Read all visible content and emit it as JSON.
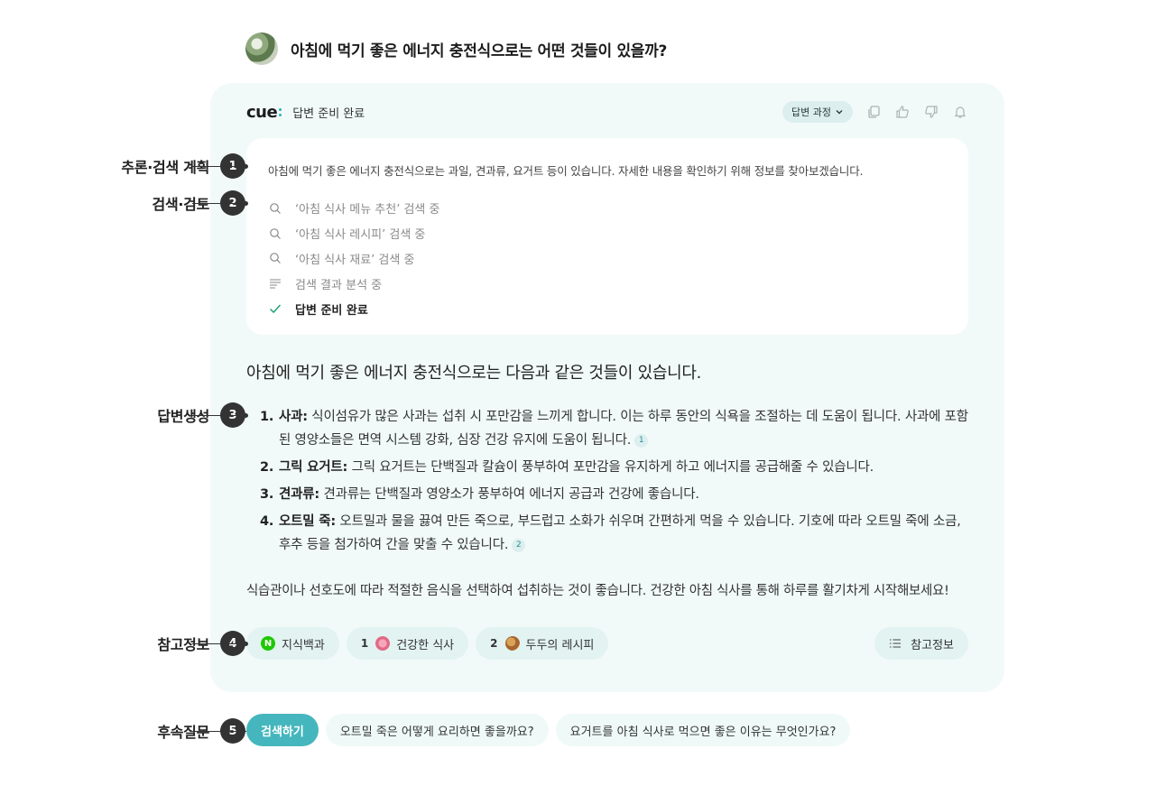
{
  "question": {
    "text": "아침에 먹기 좋은 에너지 충전식으로는 어떤 것들이 있을까?"
  },
  "card": {
    "logo": "cue",
    "status_title": "답변 준비 완료",
    "process_label": "답변 과정",
    "plan_text": "아침에 먹기 좋은 에너지 충전식으로는 과일, 견과류, 요거트 등이 있습니다. 자세한 내용을 확인하기 위해 정보를 찾아보겠습니다.",
    "steps": [
      {
        "icon": "search-icon",
        "text": "‘아침 식사 메뉴 추천’ 검색 중"
      },
      {
        "icon": "search-icon",
        "text": "‘아침 식사 레시피’ 검색 중"
      },
      {
        "icon": "search-icon",
        "text": "‘아침 식사 재료’ 검색 중"
      },
      {
        "icon": "lines-icon",
        "text": "검색 결과 분석 중"
      },
      {
        "icon": "check-icon",
        "text": "답변 준비 완료"
      }
    ],
    "answer_lead": "아침에 먹기 좋은 에너지 충전식으로는 다음과 같은 것들이 있습니다.",
    "items": [
      {
        "num": "1.",
        "term": "사과:",
        "text": " 식이섬유가 많은 사과는 섭취 시 포만감을 느끼게 합니다. 이는 하루 동안의 식욕을 조절하는 데 도움이 됩니다. 사과에 포함된 영양소들은 면역 시스템 강화, 심장 건강 유지에 도움이 됩니다.",
        "cite": "1"
      },
      {
        "num": "2.",
        "term": "그릭 요거트:",
        "text": " 그릭 요거트는 단백질과 칼슘이 풍부하여 포만감을 유지하게 하고 에너지를 공급해줄 수 있습니다.",
        "cite": ""
      },
      {
        "num": "3.",
        "term": "견과류:",
        "text": " 견과류는 단백질과 영양소가 풍부하여 에너지 공급과 건강에 좋습니다.",
        "cite": ""
      },
      {
        "num": "4.",
        "term": "오트밀 죽:",
        "text": " 오트밀과 물을 끓여 만든 죽으로, 부드럽고 소화가 쉬우며 간편하게 먹을 수 있습니다. 기호에 따라 오트밀 죽에 소금, 후추 등을 첨가하여 간을 맞출 수 있습니다.",
        "cite": "2"
      }
    ],
    "closing": "식습관이나 선호도에 따라 적절한 음식을 선택하여 섭취하는 것이 좋습니다. 건강한 아침 식사를 통해 하루를 활기차게 시작해보세요!",
    "refs": [
      {
        "num": "",
        "icon": "naver-n",
        "logo_text": "N",
        "label": "지식백과"
      },
      {
        "num": "1",
        "icon": "flower-thumb",
        "label": "건강한 식사"
      },
      {
        "num": "2",
        "icon": "food-thumb",
        "label": "두두의 레시피"
      }
    ],
    "refs_button": "참고정보"
  },
  "followups": {
    "search_button": "검색하기",
    "suggestions": [
      "오트밀 죽은 어떻게 요리하면 좋을까요?",
      "요거트를 아침 식사로 먹으면 좋은 이유는 무엇인가요?"
    ]
  },
  "annotations": [
    {
      "num": "1",
      "label": "추론·검색 계획"
    },
    {
      "num": "2",
      "label": "검색·검토"
    },
    {
      "num": "3",
      "label": "답변생성"
    },
    {
      "num": "4",
      "label": "참고정보"
    },
    {
      "num": "5",
      "label": "후속질문"
    }
  ],
  "colors": {
    "accent": "#45b6bd",
    "card_bg": "#f1faf8",
    "chip_bg": "#e2f3f1",
    "naver_green": "#1ec800"
  }
}
